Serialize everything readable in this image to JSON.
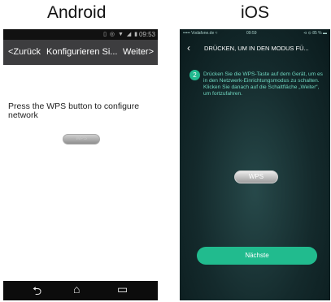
{
  "titles": {
    "android": "Android",
    "ios": "iOS"
  },
  "android": {
    "status_icons": "▯ ◎ ▼ ◢ ▮",
    "time": "09:53",
    "back_label": "<Zurück",
    "title": "Konfigurieren Si...",
    "next_label": "Weiter>",
    "message": "Press the WPS button to configure network",
    "wps_label": "WPS",
    "nav": {
      "back": "⮌",
      "home": "⌂",
      "recents": "▭"
    }
  },
  "ios": {
    "carrier": "••••• Vodafone.de ≈",
    "time": "09:59",
    "status_right": "⊲ ⊙ 85 % ▬",
    "back_icon": "‹",
    "title": "DRÜCKEN, UM IN DEN MODUS FÜ...",
    "step_number": "2",
    "instructions": "Drücken Sie die WPS-Taste auf dem Gerät, um es in den Netzwerk-Einrichtungsmodus zu schalten. Klicken Sie danach auf die Schaltfläche „Weiter“, um fortzufahren.",
    "wps_label": "WPS",
    "next_button": "Nächste"
  }
}
